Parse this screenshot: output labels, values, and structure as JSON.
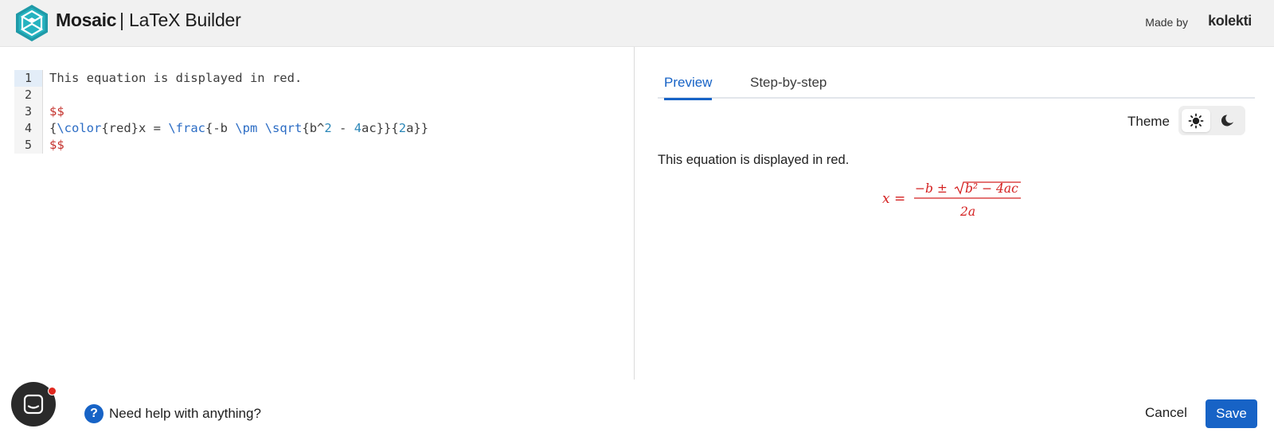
{
  "header": {
    "app_name": "Mosaic",
    "separator": "|",
    "app_subtitle": "LaTeX Builder",
    "made_by_label": "Made by",
    "brand": "kolekti"
  },
  "editor": {
    "lines": [
      {
        "number": "1",
        "tokens": [
          {
            "type": "plain",
            "text": "This equation is displayed in red."
          }
        ]
      },
      {
        "number": "2",
        "tokens": []
      },
      {
        "number": "3",
        "tokens": [
          {
            "type": "dollar",
            "text": "$$"
          }
        ]
      },
      {
        "number": "4",
        "tokens": [
          {
            "type": "plain",
            "text": "{"
          },
          {
            "type": "cmd",
            "text": "\\color"
          },
          {
            "type": "plain",
            "text": "{red}x = "
          },
          {
            "type": "cmd",
            "text": "\\frac"
          },
          {
            "type": "plain",
            "text": "{-b "
          },
          {
            "type": "cmd",
            "text": "\\pm"
          },
          {
            "type": "plain",
            "text": " "
          },
          {
            "type": "cmd",
            "text": "\\sqrt"
          },
          {
            "type": "plain",
            "text": "{b^"
          },
          {
            "type": "num",
            "text": "2"
          },
          {
            "type": "plain",
            "text": " - "
          },
          {
            "type": "num",
            "text": "4"
          },
          {
            "type": "plain",
            "text": "ac}}{"
          },
          {
            "type": "num",
            "text": "2"
          },
          {
            "type": "plain",
            "text": "a}}"
          }
        ]
      },
      {
        "number": "5",
        "tokens": [
          {
            "type": "dollar",
            "text": "$$"
          }
        ]
      }
    ]
  },
  "preview": {
    "tabs": [
      {
        "label": "Preview",
        "active": true
      },
      {
        "label": "Step-by-step",
        "active": false
      }
    ],
    "theme_label": "Theme",
    "theme_selected": "light",
    "rendered_text": "This equation is displayed in red.",
    "equation": {
      "lhs": "x =",
      "numerator_a": "−b ±",
      "radicand": "b² − 4ac",
      "denominator": "2a",
      "color": "#d42020"
    }
  },
  "footer": {
    "help_icon_glyph": "?",
    "help_text": "Need help with anything?",
    "cancel_label": "Cancel",
    "save_label": "Save"
  },
  "colors": {
    "accent": "#1763c6",
    "equation_red": "#d42020",
    "notification_red": "#e0281f"
  }
}
